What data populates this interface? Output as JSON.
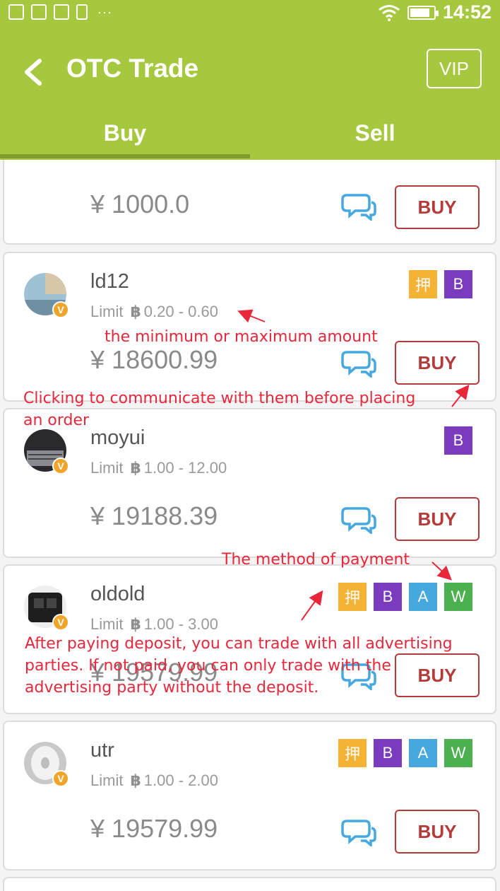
{
  "status_bar": {
    "time": "14:52",
    "overflow": "···",
    "battery_level": 0.85
  },
  "header": {
    "back_icon": "chevron-left-icon",
    "title": "OTC Trade",
    "vip_label": "VIP"
  },
  "tabs": [
    {
      "label": "Buy",
      "active": true
    },
    {
      "label": "Sell",
      "active": false
    }
  ],
  "currency_symbol": "¥",
  "limit_label": "Limit",
  "btc_symbol": "฿",
  "buy_label": "BUY",
  "badge_colors": {
    "押": "#f5b335",
    "B": "#7b3bbf",
    "A": "#47a8e0",
    "W": "#4caf50"
  },
  "listings": [
    {
      "price": "1000.0",
      "partial": true
    },
    {
      "user": "ld12",
      "limit": "0.20 - 0.60",
      "price": "18600.99",
      "badges": [
        "押",
        "B"
      ]
    },
    {
      "user": "moyui",
      "limit": "1.00 - 12.00",
      "price": "19188.39",
      "badges": [
        "B"
      ]
    },
    {
      "user": "oldold",
      "limit": "1.00 - 3.00",
      "price": "19579.99",
      "badges": [
        "押",
        "B",
        "A",
        "W"
      ]
    },
    {
      "user": "utr",
      "limit": "1.00 - 2.00",
      "price": "19579.99",
      "badges": [
        "押",
        "B",
        "A",
        "W"
      ]
    }
  ],
  "annotations": {
    "min_max": "the minimum or maximum amount",
    "communicate_line1": "Clicking to communicate with them before placing",
    "communicate_line2": "an order",
    "payment_method": "The method of payment",
    "deposit_line1": "After paying deposit, you can trade with all advertising",
    "deposit_line2": " parties. If not paid, you can only trade with the",
    "deposit_line3": "advertising party without the deposit."
  }
}
